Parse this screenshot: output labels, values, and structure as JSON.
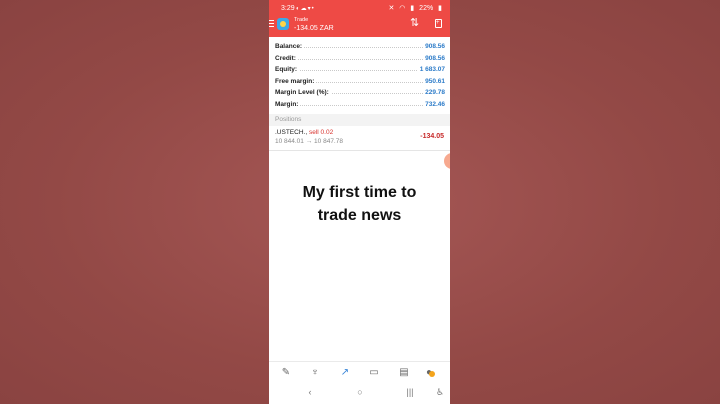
{
  "status": {
    "time": "3:29",
    "battery": "22%"
  },
  "header": {
    "title": "Trade",
    "subtitle": "-134.05 ZAR"
  },
  "account": [
    {
      "label": "Balance:",
      "value": "908.56"
    },
    {
      "label": "Credit:",
      "value": "908.56"
    },
    {
      "label": "Equity:",
      "value": "1 683.07"
    },
    {
      "label": "Free margin:",
      "value": "950.61"
    },
    {
      "label": "Margin Level (%):",
      "value": "229.78"
    },
    {
      "label": "Margin:",
      "value": "732.46"
    }
  ],
  "positions": {
    "header": "Positions",
    "items": [
      {
        "symbol": ".USTECH.,",
        "side": "sell 0.02",
        "open_price": "10 844.01",
        "arrow": "→",
        "current_price": "10 847.78",
        "pl": "-134.05"
      }
    ]
  },
  "caption": {
    "line1": "My first time to",
    "line2": "trade news"
  },
  "icons": {
    "accent": "#ee4a45",
    "link_blue": "#2d7cc9",
    "loss_red": "#c62828"
  }
}
